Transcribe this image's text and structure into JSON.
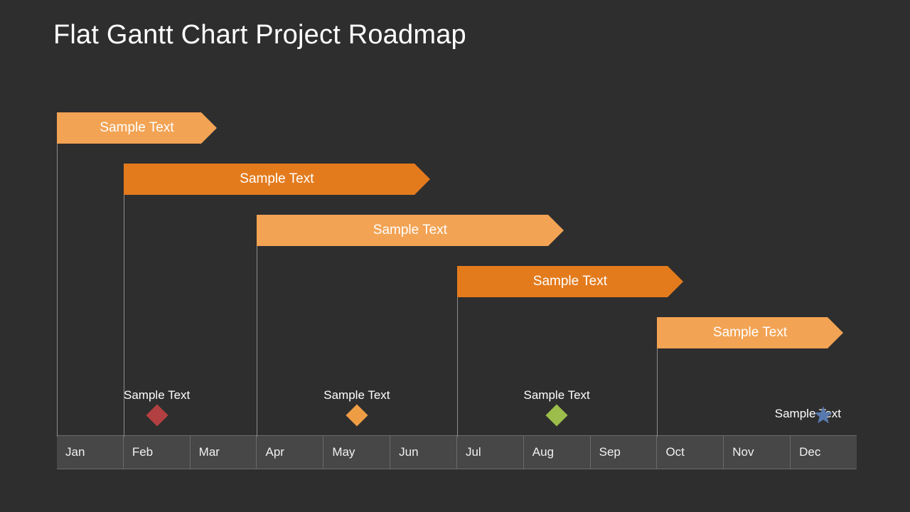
{
  "title": "Flat Gantt Chart Project Roadmap",
  "months": [
    "Jan",
    "Feb",
    "Mar",
    "Apr",
    "May",
    "Jun",
    "Jul",
    "Aug",
    "Sep",
    "Oct",
    "Nov",
    "Dec"
  ],
  "bars": [
    {
      "label": "Sample Text",
      "start_month": 1,
      "end_month": 3.4,
      "row": 0,
      "color": "light"
    },
    {
      "label": "Sample Text",
      "start_month": 2,
      "end_month": 6.6,
      "row": 1,
      "color": "dark"
    },
    {
      "label": "Sample Text",
      "start_month": 4,
      "end_month": 8.6,
      "row": 2,
      "color": "light"
    },
    {
      "label": "Sample Text",
      "start_month": 7,
      "end_month": 10.4,
      "row": 3,
      "color": "dark"
    },
    {
      "label": "Sample Text",
      "start_month": 10,
      "end_month": 12.8,
      "row": 4,
      "color": "light"
    }
  ],
  "milestones": [
    {
      "label": "Sample Text",
      "month": 2.5,
      "shape": "diamond",
      "color": "red"
    },
    {
      "label": "Sample Text",
      "month": 5.5,
      "shape": "diamond",
      "color": "orange"
    },
    {
      "label": "Sample Text",
      "month": 8.5,
      "shape": "diamond",
      "color": "green"
    },
    {
      "label": "Sample Text",
      "month": 12.5,
      "shape": "star",
      "color": "blue"
    }
  ],
  "colors": {
    "bg": "#2e2e2e",
    "bar_light": "#f2a354",
    "bar_dark": "#e37b1d",
    "diamond_red": "#b24041",
    "diamond_orange": "#ef9d45",
    "diamond_green": "#9cbd4a",
    "star_blue": "#5879b0"
  },
  "chart_data": {
    "type": "bar",
    "orientation": "gantt",
    "title": "Flat Gantt Chart Project Roadmap",
    "x_categories": [
      "Jan",
      "Feb",
      "Mar",
      "Apr",
      "May",
      "Jun",
      "Jul",
      "Aug",
      "Sep",
      "Oct",
      "Nov",
      "Dec"
    ],
    "xlim": [
      1,
      13
    ],
    "series": [
      {
        "name": "Sample Text",
        "start": 1,
        "end": 3.4,
        "color": "#f2a354"
      },
      {
        "name": "Sample Text",
        "start": 2,
        "end": 6.6,
        "color": "#e37b1d"
      },
      {
        "name": "Sample Text",
        "start": 4,
        "end": 8.6,
        "color": "#f2a354"
      },
      {
        "name": "Sample Text",
        "start": 7,
        "end": 10.4,
        "color": "#e37b1d"
      },
      {
        "name": "Sample Text",
        "start": 10,
        "end": 12.8,
        "color": "#f2a354"
      }
    ],
    "milestones": [
      {
        "name": "Sample Text",
        "x": 2.5,
        "marker": "diamond",
        "color": "#b24041"
      },
      {
        "name": "Sample Text",
        "x": 5.5,
        "marker": "diamond",
        "color": "#ef9d45"
      },
      {
        "name": "Sample Text",
        "x": 8.5,
        "marker": "diamond",
        "color": "#9cbd4a"
      },
      {
        "name": "Sample Text",
        "x": 12.5,
        "marker": "star",
        "color": "#5879b0"
      }
    ]
  }
}
